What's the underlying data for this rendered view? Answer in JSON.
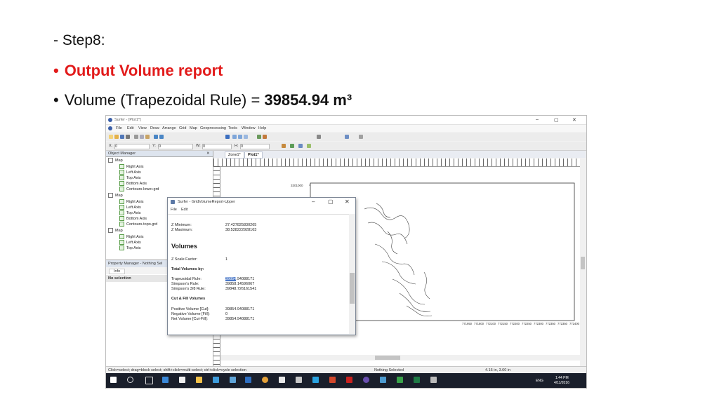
{
  "slide": {
    "step": "- Step8:",
    "bullet_char": "•",
    "bullet1": "Output Volume report",
    "bullet2_prefix": "Volume (Trapezoidal Rule) = ",
    "bullet2_value": "39854.94 m³"
  },
  "surfer": {
    "title": "Surfer - [Plot1*]",
    "window_controls": {
      "min": "–",
      "max": "▢",
      "close": "✕"
    },
    "menu": [
      "File",
      "Edit",
      "View",
      "Draw",
      "Arrange",
      "Grid",
      "Map",
      "Geoprocessing",
      "Tools",
      "Window",
      "Help"
    ],
    "toolbar_x_label": "X:",
    "toolbar_y_label": "Y:",
    "toolbar_w_label": "W:",
    "toolbar_h_label": "H:",
    "toolbar_x_value": "0",
    "toolbar_y_value": "0",
    "toolbar_w_value": "0",
    "toolbar_h_value": "0",
    "object_manager": {
      "title": "Object Manager",
      "items": [
        {
          "label": "Map",
          "level": 0
        },
        {
          "label": "Right Axis",
          "level": 1
        },
        {
          "label": "Left Axis",
          "level": 1
        },
        {
          "label": "Top Axis",
          "level": 1
        },
        {
          "label": "Bottom Axis",
          "level": 1
        },
        {
          "label": "Contours-lower.grd",
          "level": 1
        },
        {
          "label": "Map",
          "level": 0
        },
        {
          "label": "Right Axis",
          "level": 1
        },
        {
          "label": "Left Axis",
          "level": 1
        },
        {
          "label": "Top Axis",
          "level": 1
        },
        {
          "label": "Bottom Axis",
          "level": 1
        },
        {
          "label": "Contours-topo.grd",
          "level": 1
        },
        {
          "label": "Map",
          "level": 0
        },
        {
          "label": "Right Axis",
          "level": 1
        },
        {
          "label": "Left Axis",
          "level": 1
        },
        {
          "label": "Top Axis",
          "level": 1
        }
      ]
    },
    "property_manager": {
      "title": "Property Manager - Nothing Sel",
      "tab": "Info",
      "selection": "No selection"
    },
    "doc_tabs": [
      "Zone1*",
      "Plot1*"
    ],
    "axis_labels": [
      "3301000",
      "3300900"
    ],
    "x_axis_ticks": [
      "771950",
      "771800",
      "772100",
      "772150",
      "772200",
      "772250",
      "772300",
      "772350",
      "772350",
      "772400"
    ],
    "status": {
      "hint": "Click=select; drag=block select; shift+click=multi-select; ctrl+click=cycle selection",
      "selected": "Nothing Selected",
      "coords": "4.16 in, 3.60 in"
    },
    "taskbar": {
      "time": "1:44 PM",
      "date": "4/11/2016",
      "lang": "ENG"
    },
    "dialog": {
      "title": "Surfer - GridVolumeReport-Upper",
      "menu": [
        "File",
        "Edit"
      ],
      "zmin_label": "Z Minimum:",
      "zmin_value": "27.427825830265",
      "zmax_label": "Z Maximum:",
      "zmax_value": "38.528222928163",
      "volumes_heading": "Volumes",
      "zscale_label": "Z Scale Factor:",
      "zscale_value": "1",
      "total_heading": "Total Volumes by:",
      "trap_label": "Trapezoidal Rule:",
      "trap_value_hl": "39854",
      "trap_value_rest": ".94088171",
      "simp_label": "Simpson's Rule:",
      "simp_value": "39858.14596067",
      "simp38_label": "Simpson's 3/8 Rule:",
      "simp38_value": "39848.726161541",
      "cutfill_heading": "Cut & Fill Volumes",
      "pos_label": "Positive Volume [Cut]:",
      "pos_value": "39854.94088171",
      "neg_label": "Negative Volume [Fill]:",
      "neg_value": "0",
      "net_label": "Net Volume [Cut-Fill]:",
      "net_value": "39854.94088171"
    }
  }
}
